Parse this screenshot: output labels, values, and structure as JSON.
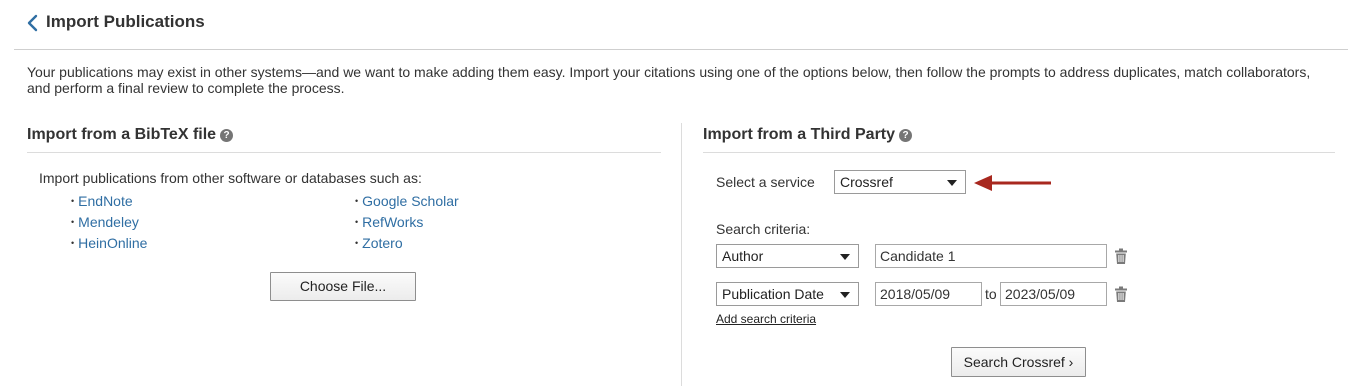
{
  "header": {
    "title": "Import Publications"
  },
  "intro": "Your publications may exist in other systems—and we want to make adding them easy. Import your citations using one of the options below, then follow the prompts to address duplicates, match collaborators, and perform a final review to complete the process.",
  "bibtex": {
    "title": "Import from a BibTeX file",
    "description": "Import publications from other software or databases such as:",
    "links_left": [
      "EndNote",
      "Mendeley",
      "HeinOnline"
    ],
    "links_right": [
      "Google Scholar",
      "RefWorks",
      "Zotero"
    ],
    "choose_file_label": "Choose File..."
  },
  "third_party": {
    "title": "Import from a Third Party",
    "service_label": "Select a service",
    "service_value": "Crossref",
    "criteria_label": "Search criteria:",
    "criteria": [
      {
        "field": "Author",
        "value": "Candidate 1"
      },
      {
        "field": "Publication Date",
        "from": "2018/05/09",
        "to_label": "to",
        "to": "2023/05/09"
      }
    ],
    "add_criteria_label": "Add search criteria",
    "search_button_label": "Search Crossref ›"
  },
  "colors": {
    "link": "#2f6ea3",
    "arrow": "#a8281f"
  }
}
